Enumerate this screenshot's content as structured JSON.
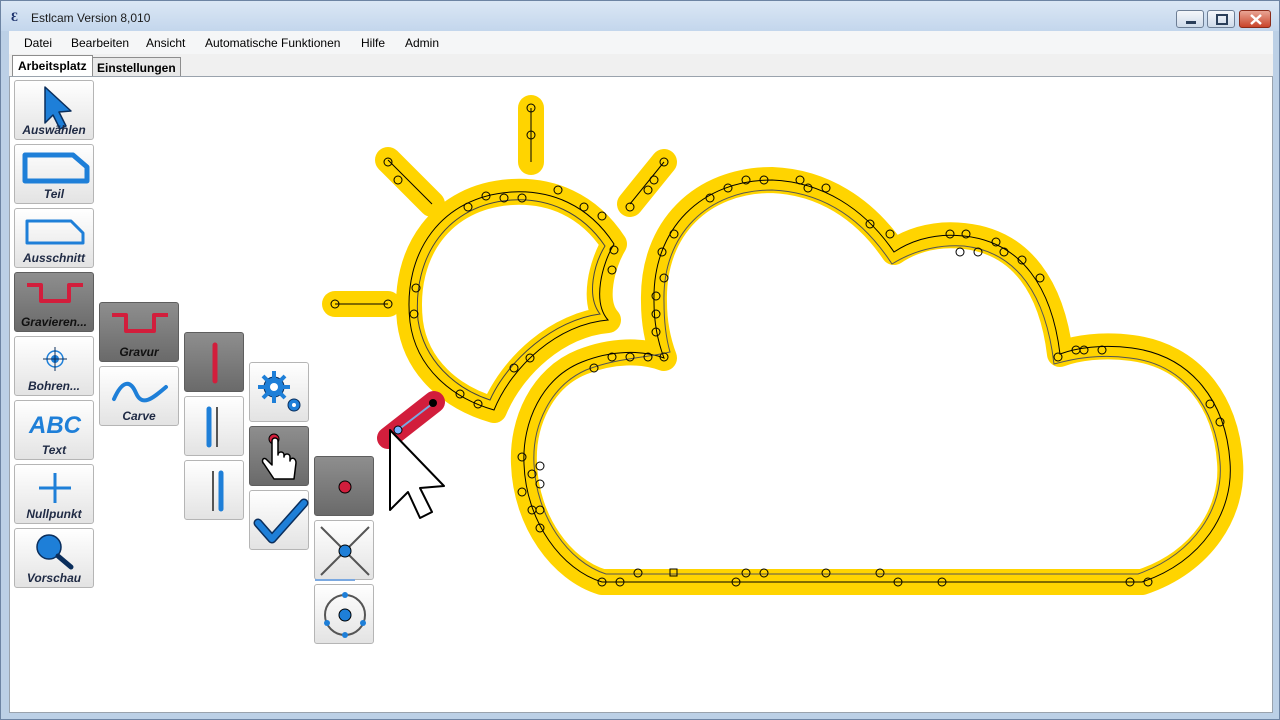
{
  "window": {
    "title": "Estlcam Version 8,010",
    "app_icon_glyph": "Ɛ"
  },
  "menu": {
    "items": [
      {
        "label": "Datei"
      },
      {
        "label": "Bearbeiten"
      },
      {
        "label": "Ansicht"
      },
      {
        "label": "Automatische Funktionen"
      },
      {
        "label": "Hilfe"
      },
      {
        "label": "Admin"
      }
    ]
  },
  "tabs": [
    {
      "label": "Arbeitsplatz",
      "active": true
    },
    {
      "label": "Einstellungen",
      "active": false
    }
  ],
  "toolbar": {
    "main": [
      {
        "label": "Auswählen",
        "icon": "cursor-arrow-icon"
      },
      {
        "label": "Teil",
        "icon": "part-outline-icon"
      },
      {
        "label": "Ausschnitt",
        "icon": "cutout-outline-icon"
      },
      {
        "label": "Gravieren...",
        "icon": "engrave-icon",
        "selected": true
      },
      {
        "label": "Bohren...",
        "icon": "drill-crosshair-icon"
      },
      {
        "label": "Text",
        "icon": "text-abc-icon"
      },
      {
        "label": "Nullpunkt",
        "icon": "zero-point-plus-icon"
      },
      {
        "label": "Vorschau",
        "icon": "magnifier-icon"
      }
    ],
    "engrave_sub": [
      {
        "label": "Gravur",
        "icon": "engrave-icon",
        "selected": true
      },
      {
        "label": "Carve",
        "icon": "carve-wave-icon"
      }
    ]
  },
  "colors": {
    "toolpath_yellow": "#FFD400",
    "selected_red": "#D21E3C",
    "icon_blue": "#1E7FD8",
    "canvas_bg": "#FFFFFF"
  }
}
